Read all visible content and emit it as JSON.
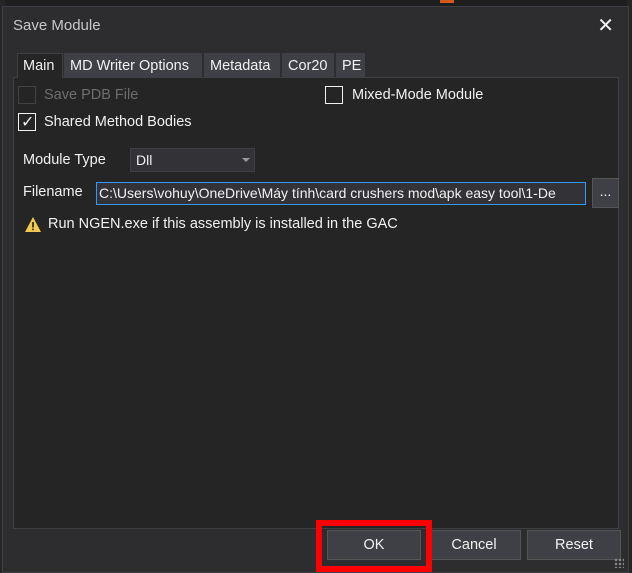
{
  "dialog": {
    "title": "Save Module",
    "close_icon": "close-icon"
  },
  "tabs": [
    {
      "label": "Main",
      "active": true
    },
    {
      "label": "MD Writer Options",
      "active": false
    },
    {
      "label": "Metadata",
      "active": false
    },
    {
      "label": "Cor20",
      "active": false
    },
    {
      "label": "PE",
      "active": false
    }
  ],
  "main": {
    "save_pdb": {
      "label": "Save PDB File",
      "checked": false,
      "enabled": false
    },
    "mixed_mode": {
      "label": "Mixed-Mode Module",
      "checked": false,
      "enabled": true
    },
    "shared_method_bodies": {
      "label": "Shared Method Bodies",
      "checked": true,
      "enabled": true
    },
    "module_type_label": "Module Type",
    "module_type_value": "Dll",
    "filename_label": "Filename",
    "filename_value": "C:\\Users\\vohuy\\OneDrive\\Máy tính\\card crushers mod\\apk easy tool\\1-De",
    "browse_label": "...",
    "warning_text": "Run NGEN.exe if this assembly is installed in the GAC"
  },
  "buttons": {
    "ok": "OK",
    "cancel": "Cancel",
    "reset": "Reset"
  },
  "colors": {
    "background": "#2d2d30",
    "panel": "#252526",
    "accent_border": "#3399ff",
    "highlight": "#ff0000",
    "warning": "#f2c94c"
  }
}
